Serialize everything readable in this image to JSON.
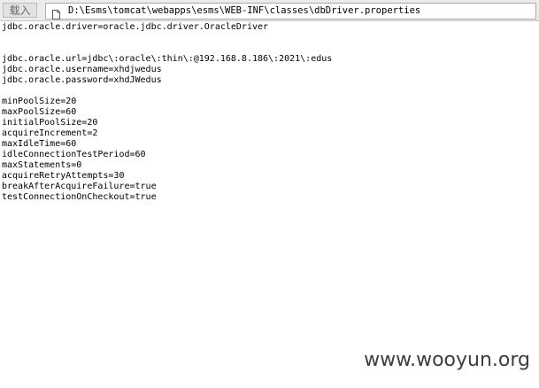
{
  "toolbar": {
    "load_label": "载入",
    "address": "D:\\Esms\\tomcat\\webapps\\esms\\WEB-INF\\classes\\dbDriver.properties",
    "address_icon": "page-icon"
  },
  "file_lines": [
    "jdbc.oracle.driver=oracle.jdbc.driver.OracleDriver",
    "",
    "",
    "jdbc.oracle.url=jdbc\\:oracle\\:thin\\:@192.168.8.186\\:2021\\:edus",
    "jdbc.oracle.username=xhdjwedus",
    "jdbc.oracle.password=xhdJWedus",
    "",
    "minPoolSize=20",
    "maxPoolSize=60",
    "initialPoolSize=20",
    "acquireIncrement=2",
    "maxIdleTime=60",
    "idleConnectionTestPeriod=60",
    "maxStatements=0",
    "acquireRetryAttempts=30",
    "breakAfterAcquireFailure=true",
    "testConnectionOnCheckout=true"
  ],
  "watermark": "www.wooyun.org"
}
